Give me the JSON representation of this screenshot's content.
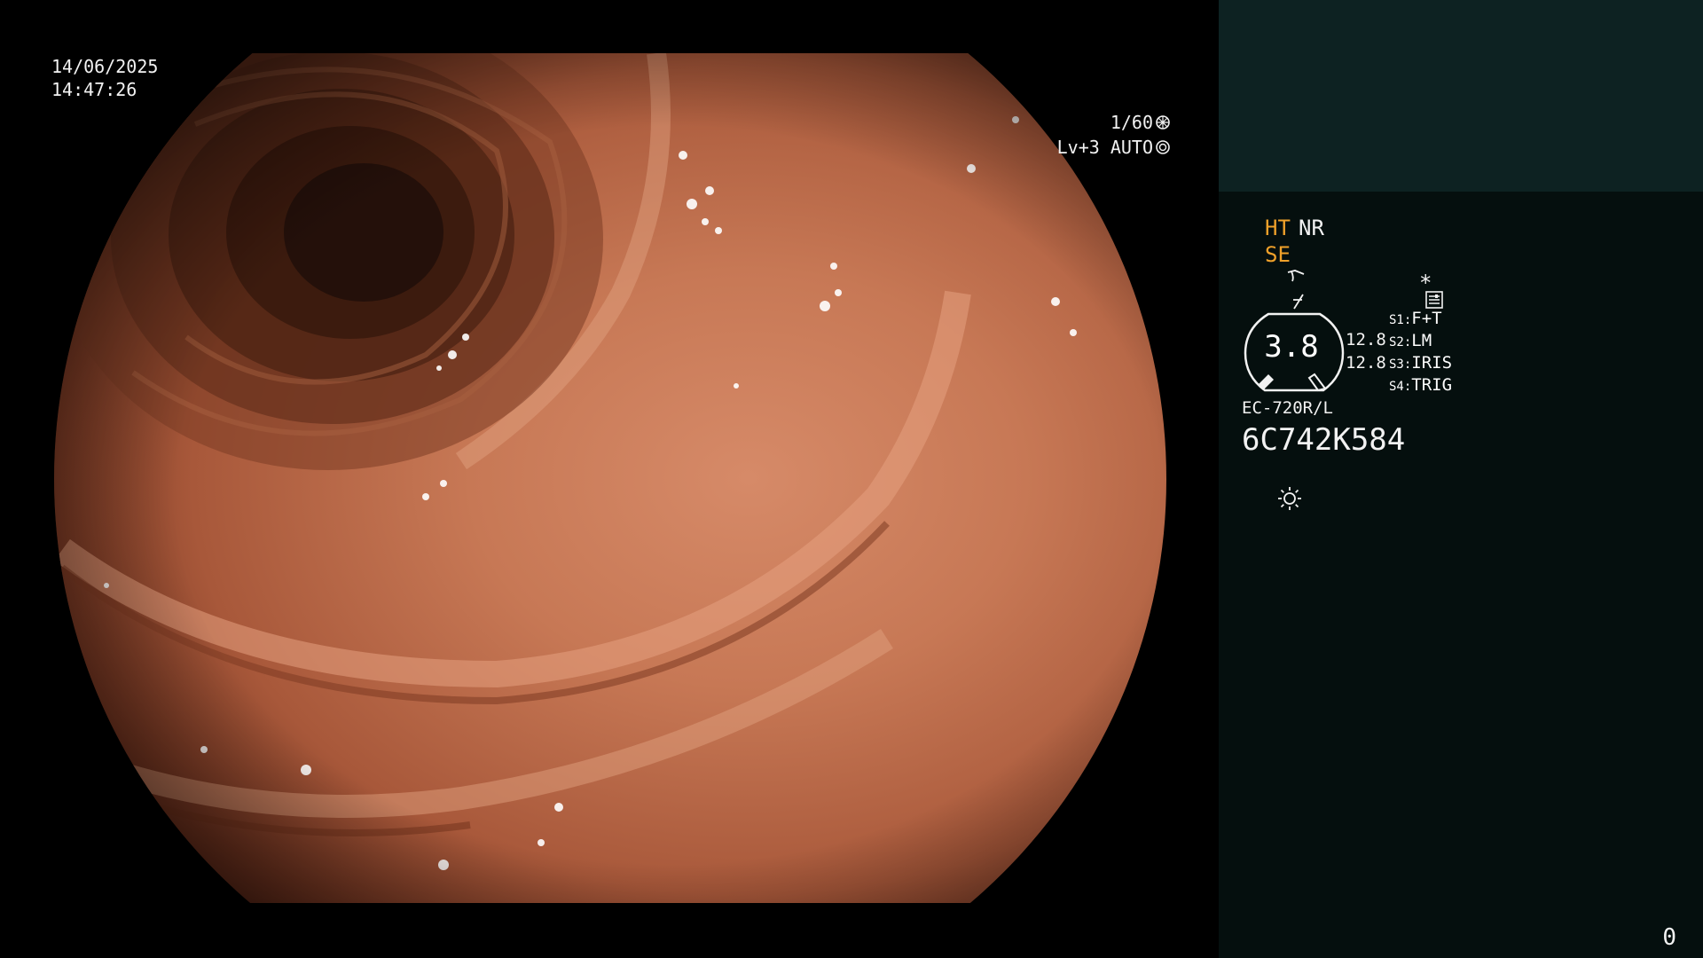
{
  "overlay": {
    "date": "14/06/2025",
    "time": "14:47:26",
    "shutter": "1/60",
    "level": "Lv+3",
    "exposure_mode": "AUTO"
  },
  "panel": {
    "ht": "HT",
    "nr": "NR",
    "se": "SE",
    "asterisk": "*",
    "gauge_value": "3.8",
    "value_a": "12.8",
    "value_b": "12.8",
    "switches": [
      {
        "key": "S1:",
        "value": "F+T"
      },
      {
        "key": "S2:",
        "value": "LM"
      },
      {
        "key": "S3:",
        "value": "IRIS"
      },
      {
        "key": "S4:",
        "value": "TRIG"
      }
    ],
    "scope_model": "EC-720R/L",
    "scope_serial": "6C742K584",
    "frame_count": "0"
  },
  "colors": {
    "amber": "#f0a12a",
    "panel_top": "#0d2222",
    "panel_bottom": "#050f0e"
  }
}
